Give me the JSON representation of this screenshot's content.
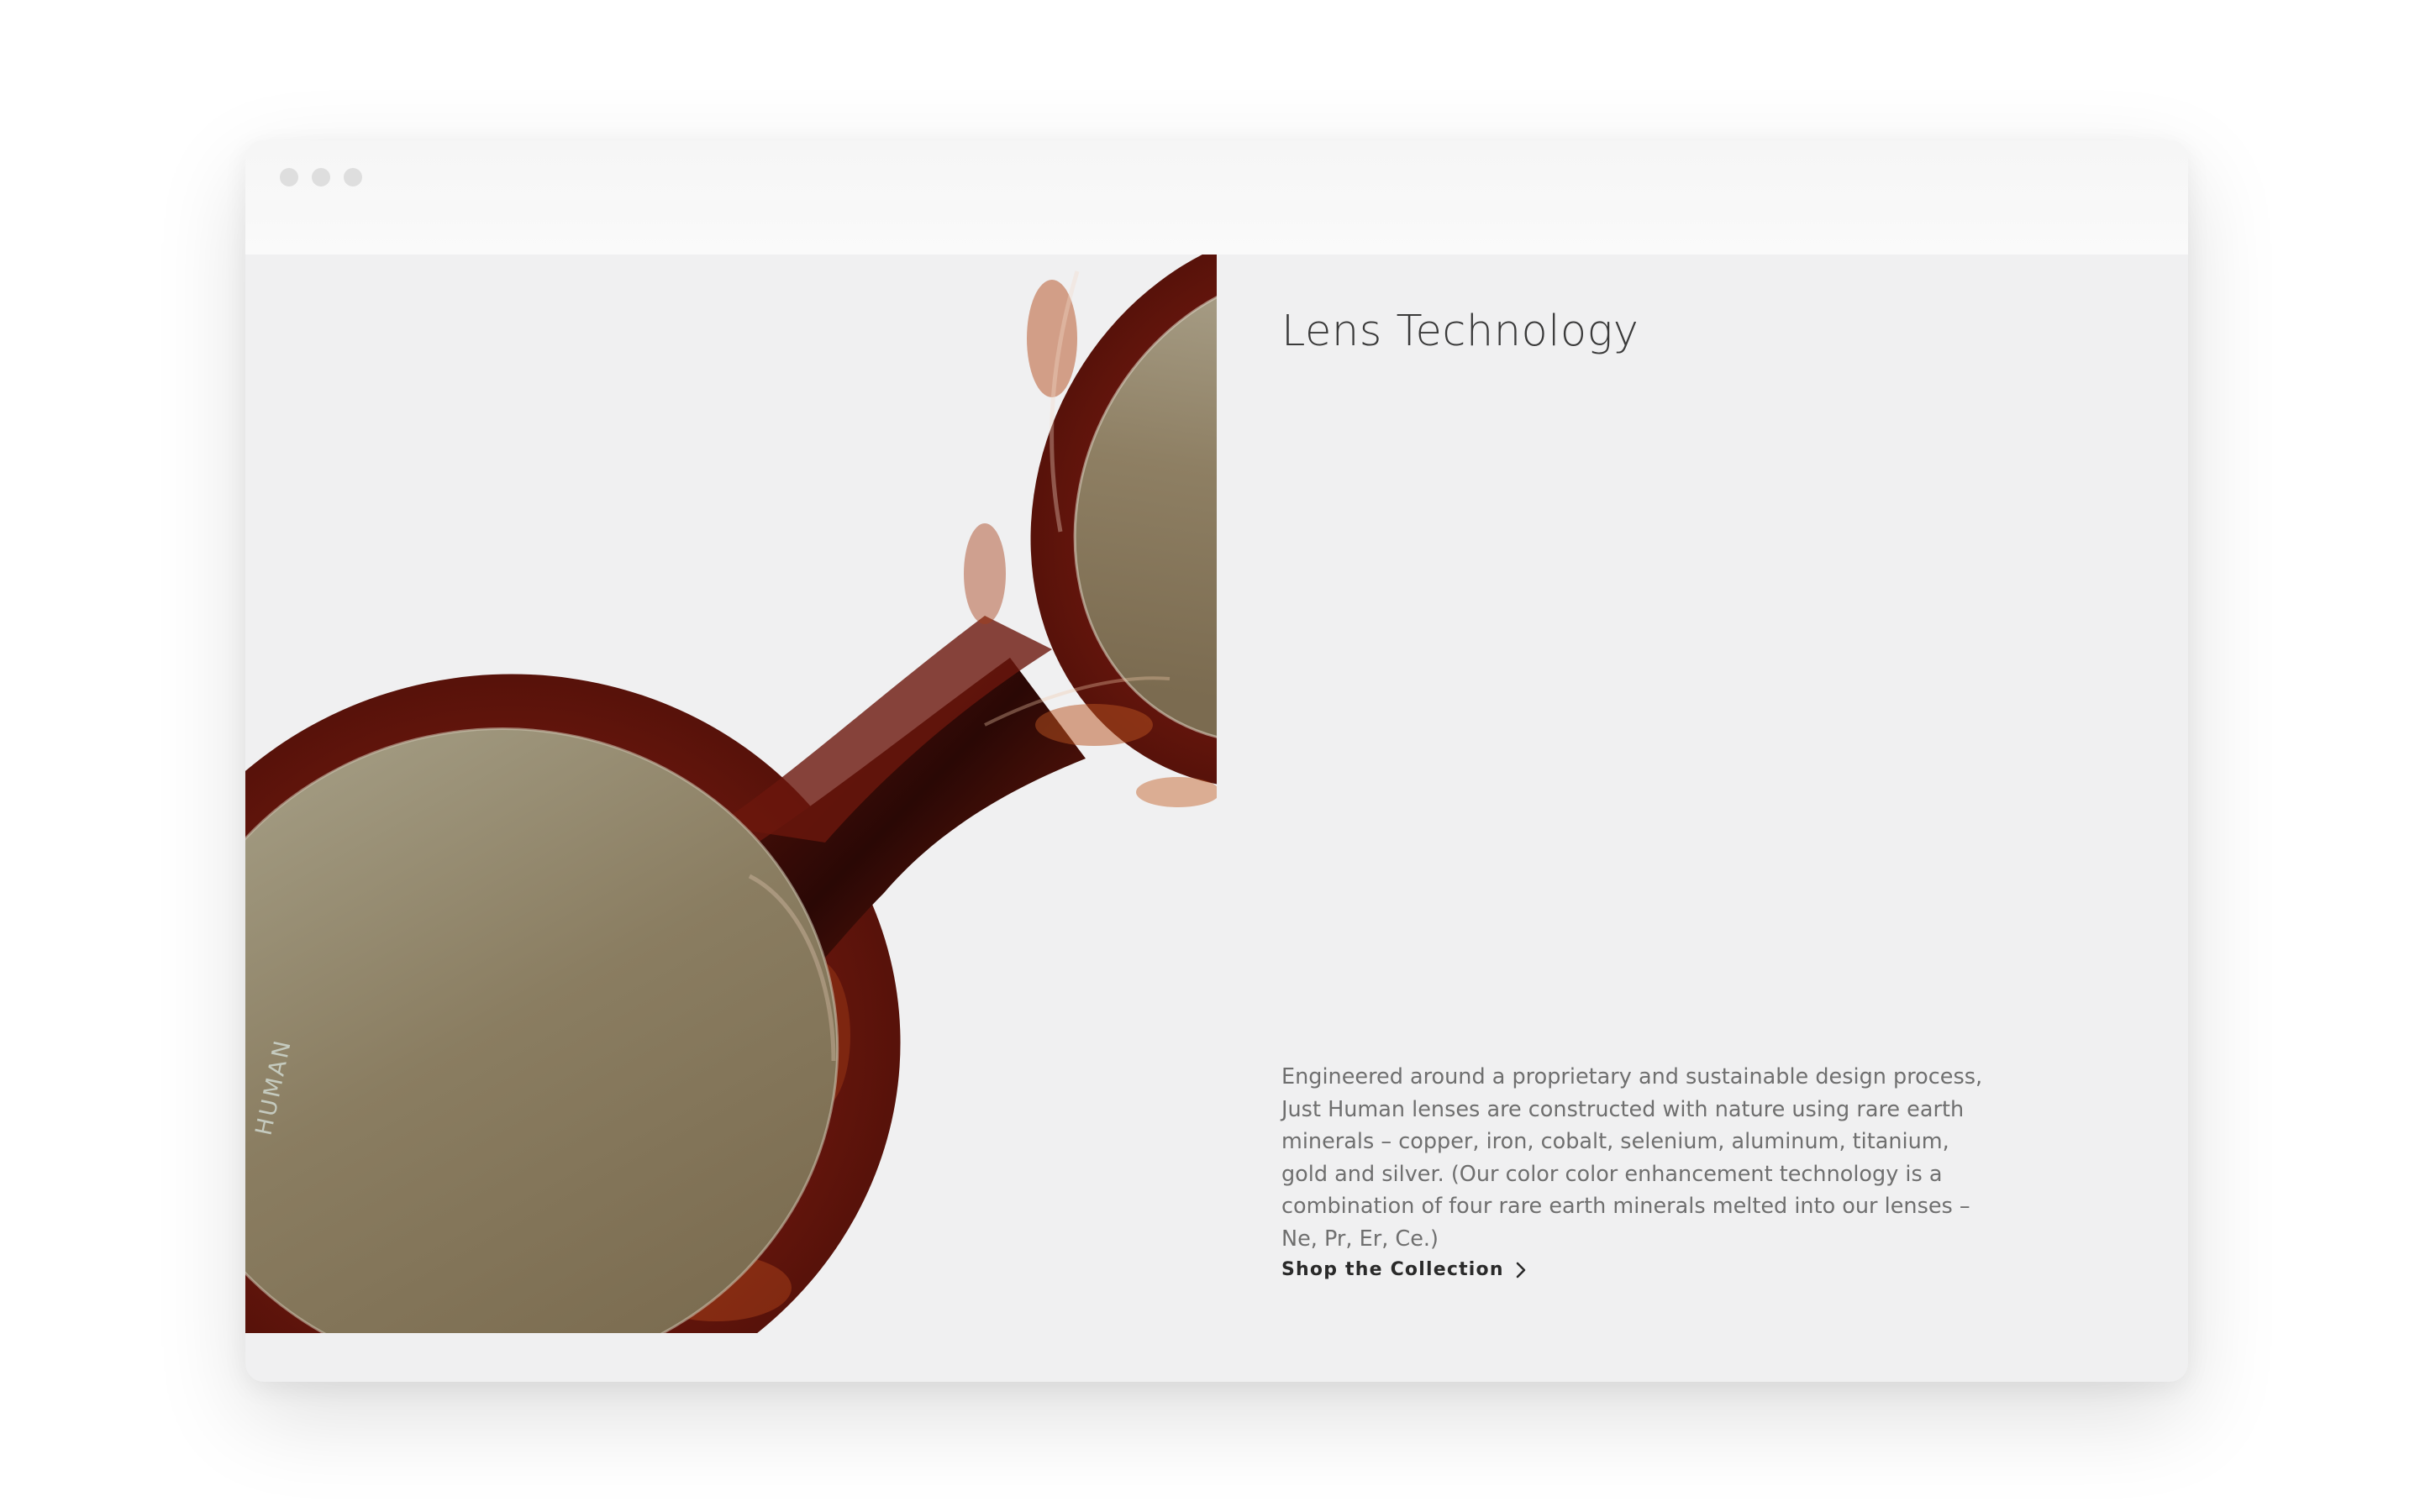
{
  "window": {
    "controls": [
      "close",
      "minimize",
      "maximize"
    ]
  },
  "hero": {
    "image_icon": "sunglasses-photo",
    "frame_engraving": "HUMAN",
    "colors": {
      "background": "#f0f0f1",
      "tortoise": "#6e1a10",
      "lens": "#7d6e55"
    }
  },
  "section": {
    "title": "Lens Technology",
    "description": "Engineered around a proprietary and sustainable design process, Just Human lenses are constructed with nature using rare earth minerals – copper, iron, cobalt, selenium, aluminum, titanium, gold and silver. (Our color color enhancement technology is a combination of four rare earth minerals melted into our lenses – Ne, Pr, Er, Ce.)",
    "cta_label": "Shop the Collection",
    "cta_icon": "chevron-right-icon"
  }
}
